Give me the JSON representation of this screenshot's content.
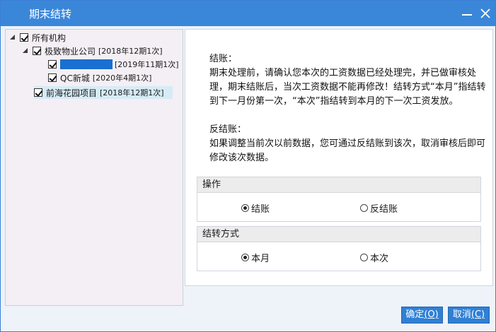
{
  "window": {
    "title": "期末结转"
  },
  "tree": {
    "root": {
      "label": "所有机构",
      "checked": true
    },
    "company": {
      "label": "极致物业公司",
      "period": "[2018年12期1次]",
      "checked": true
    },
    "child1": {
      "label": "",
      "period": "[2019年11期1次]",
      "checked": true
    },
    "child2": {
      "label": "QC新城",
      "period": "[2020年4期1次]",
      "checked": true
    },
    "project": {
      "label": "前海花园项目",
      "period": "[2018年12期1次]",
      "checked": true
    }
  },
  "info": {
    "close_title": "结账：",
    "close_text": "期末处理前，请确认您本次的工资数据已经处理完，并已做审核处理，期末结账后，当次工资数据不能再修改！结转方式“本月”指结转到下一月份第一次，“本次”指结转到本月的下一次工资发放。",
    "reverse_title": "反结账：",
    "reverse_text": "如果调整当前次以前数据，您可通过反结账到该次，取消审核后即可修改该次数据。"
  },
  "operation": {
    "header": "操作",
    "options": [
      "结账",
      "反结账"
    ],
    "selected": "结账"
  },
  "carry_method": {
    "header": "结转方式",
    "options": [
      "本月",
      "本次"
    ],
    "selected": "本月"
  },
  "buttons": {
    "ok_label": "确定",
    "ok_key": "(O)",
    "cancel_label": "取消",
    "cancel_key": "(C)"
  },
  "colors": {
    "titlebar": "#3a87d9",
    "button": "#2f80d5",
    "selection": "#d6ebf6"
  }
}
